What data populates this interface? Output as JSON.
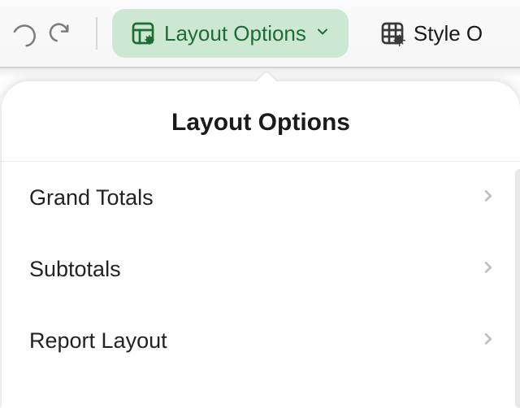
{
  "toolbar": {
    "layout_options_label": "Layout Options",
    "style_options_label": "Style O"
  },
  "popover": {
    "title": "Layout Options",
    "items": [
      {
        "label": "Grand Totals"
      },
      {
        "label": "Subtotals"
      },
      {
        "label": "Report Layout"
      }
    ]
  }
}
